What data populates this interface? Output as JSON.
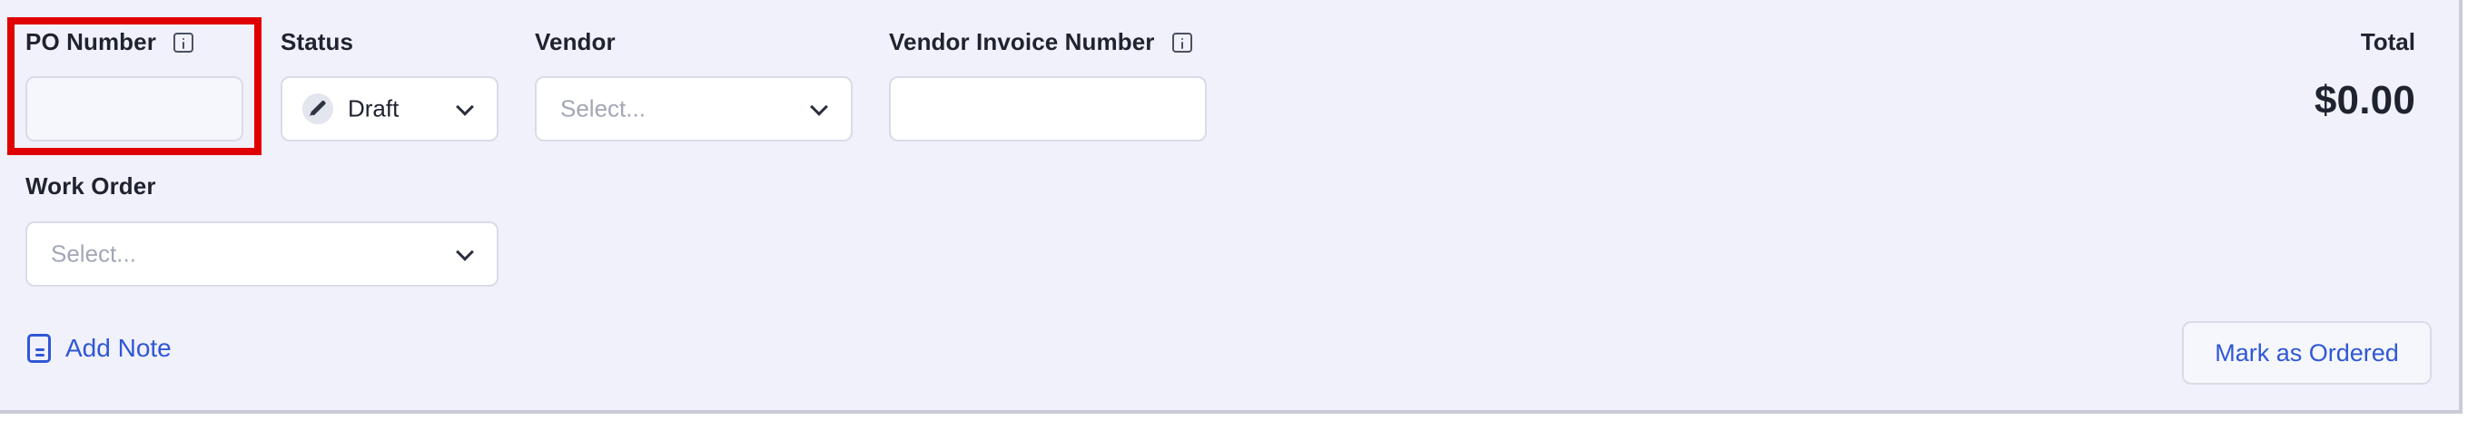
{
  "po_number": {
    "label": "PO Number",
    "value": ""
  },
  "status": {
    "label": "Status",
    "selected": "Draft"
  },
  "vendor": {
    "label": "Vendor",
    "placeholder": "Select..."
  },
  "vendor_invoice_number": {
    "label": "Vendor Invoice Number",
    "value": ""
  },
  "total": {
    "label": "Total",
    "value": "$0.00"
  },
  "work_order": {
    "label": "Work Order",
    "placeholder": "Select..."
  },
  "actions": {
    "add_note": "Add Note",
    "mark_as_ordered": "Mark as Ordered"
  },
  "colors": {
    "accent": "#2f57d6",
    "highlight": "#e10000",
    "panel_bg": "#f1f1fb"
  },
  "icons": {
    "info": "info-icon",
    "chevron": "chevron-down-icon",
    "pencil": "pencil-icon",
    "note": "note-icon"
  }
}
